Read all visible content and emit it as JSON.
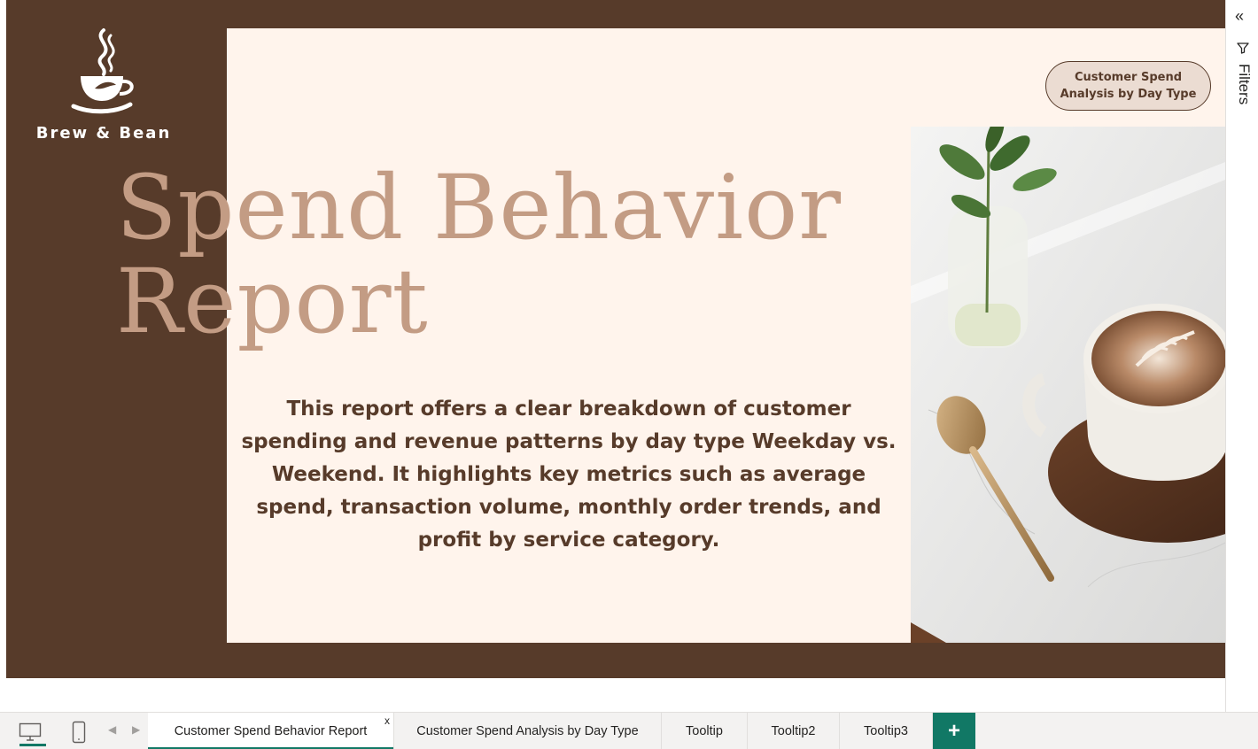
{
  "brand": {
    "name": "Brew & Bean"
  },
  "report": {
    "title_line1": "Spend Behavior",
    "title_line2": "Report",
    "description": "This report offers a clear breakdown of customer spending and revenue patterns by day type Weekday vs. Weekend. It highlights key metrics such as average spend, transaction volume, monthly order trends, and profit by service category.",
    "nav_button_label": "Customer Spend Analysis by Day Type",
    "image_subject": "latte art cup on wooden saucer with gold spoon and glass vase of green leaves"
  },
  "filters_pane": {
    "label": "Filters",
    "collapse_icon": "double-chevron-left-icon",
    "funnel_icon": "filter-funnel-icon"
  },
  "tabs": [
    {
      "label": "Customer Spend Behavior Report",
      "active": true,
      "close_label": "x"
    },
    {
      "label": "Customer Spend Analysis by Day Type",
      "active": false
    },
    {
      "label": "Tooltip",
      "active": false
    },
    {
      "label": "Tooltip2",
      "active": false
    },
    {
      "label": "Tooltip3",
      "active": false
    }
  ],
  "tabbar": {
    "add_label": "+",
    "desktop_icon": "desktop-view-icon",
    "mobile_icon": "mobile-view-icon"
  },
  "colors": {
    "brown": "#573B2A",
    "cream": "#FFF4EC",
    "title": "#C39C84",
    "accent_green": "#117865"
  }
}
